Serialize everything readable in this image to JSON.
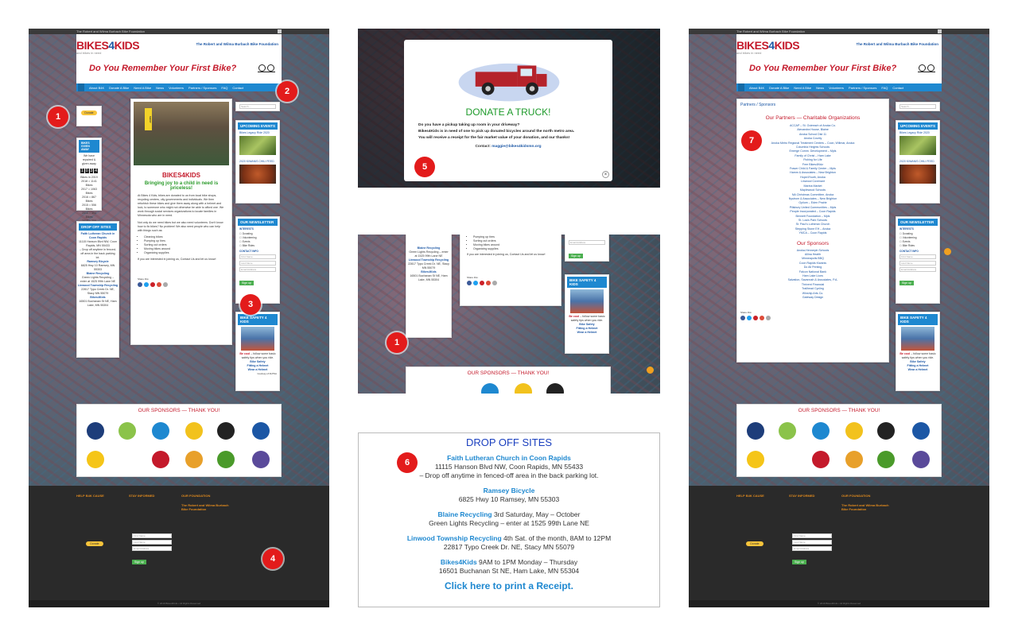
{
  "site": {
    "topbar_text": "The Robert and Wilma Burbach Bike Foundation",
    "logo_part1": "BIKES",
    "logo_part2": "4",
    "logo_part3": "KIDS",
    "tagline": "and bikes in need",
    "foundation": "The Robert and Wilma Burbach Bike Foundation",
    "headline": "Do You Remember Your First Bike?"
  },
  "nav": {
    "items_left": [
      "About B4K",
      "Donate A Bike",
      "Need A Bike",
      "News",
      "Volunteers",
      "Partners / Sponsors",
      "FAQ",
      "Contact"
    ]
  },
  "home": {
    "donate_label": "Donate",
    "bikes_given_title": "BIKES GIVEN AWAY",
    "bikes_given_sub": "We have repaired & given away",
    "counter": [
      "1",
      "0",
      "3",
      "4"
    ],
    "counter_caption": "Bikes in 2019",
    "yearly": [
      "2018 = 1141 Bikes",
      "2017 = 1063 Bikes",
      "2016 = 867 Bikes",
      "2015 = 556 Bikes",
      "2014 = 394 Bikes",
      "2013 = 359 Bikes",
      "2012 = 146 Bikes"
    ],
    "shop_sign": "SHOP",
    "main_logo": "BIKES4KIDS",
    "main_heading": "Bringing joy to a child in need is priceless!",
    "main_p1": "At Bikes 4 Kids, bikes are donated to us from local bike shops, recycling centers, city governments and individuals. We then refurbish these bikes and give them away along with a helmet and lock, to someone who might not otherwise be able to afford one. We work through social services organizations to locate families in Minnesota who are in need.",
    "main_p2": "Not only do we need bikes but we also need volunteers. Don't know how to fix bikes? No problem! We also need people who can help with things such as:",
    "main_list": [
      "Cleaning bikes",
      "Pumping up tires",
      "Sorting out orders",
      "Moving bikes around",
      "Organizing supplies"
    ],
    "main_p3": "If you are interested in joining us, Contact Us and let us know!",
    "share_label": "Share this:",
    "search_placeholder": "Search ...",
    "upcoming_title": "UPCOMING EVENTS",
    "event1": "Bikes Legacy Ride 2020",
    "event2": "2020 KIWANIS CHILI FEED",
    "newsletter_title": "OUR NEWSLETTER",
    "interests_label": "INTERESTS",
    "interests": [
      "Donating",
      "Volunteering",
      "Events",
      "Bike Rides"
    ],
    "contact_info_label": "CONTACT INFO",
    "first_name": "First Name",
    "last_name": "Last Name",
    "email": "Email Address",
    "signup": "Sign up",
    "safety_title": "BIKE SAFETY 4 KIDS",
    "safety_cool": "Be cool",
    "safety_text": " – follow some basic safety tips when you ride.",
    "safety_links": [
      "Bike Safety",
      "Fitting a Helmet",
      "Wear a Helmet"
    ],
    "safety_courtesy": "Courtesy of NHTSA",
    "dropoff_title": "DROP OFF SITES",
    "sponsors_title": "OUR SPONSORS — THANK YOU!",
    "footer_col1": "HELP B4K CAUSE",
    "footer_col2": "STAY INFORMED",
    "footer_col3": "OUR FOUNDATION",
    "footer_foundation": "The Robert and Wilma Burbach Bike Foundation",
    "copyright": "© 2019 Bikes4Kids • All Rights Reserved"
  },
  "modal": {
    "title": "DONATE A TRUCK!",
    "line1": "Do you have a pickup taking up room in your driveway?",
    "line2": "Bikes4Kids is in need of one to pick up donated bicycles around the north metro area.",
    "line3": "You will receive a receipt for the fair market value of your donation, and our thanks!",
    "contact_label": "Contact: ",
    "contact_email": "maggie@bikes4kidsmn.org",
    "close": "×"
  },
  "dropoff": {
    "title": "DROP OFF SITES",
    "sites": [
      {
        "name": "Faith Lutheran Church in Coon Rapids",
        "suffix": "",
        "line1": "11115 Hanson Blvd NW,  Coon Rapids, MN 55433",
        "line2": "– Drop off anytime in fenced-off area in the back parking lot."
      },
      {
        "name": "Ramsey Bicycle",
        "suffix": "",
        "line1": "6825 Hwy 10 Ramsey, MN 55303",
        "line2": ""
      },
      {
        "name": "Blaine Recycling",
        "suffix": " 3rd Saturday, May – October",
        "line1": "Green Lights Recycling – enter at 1525 99th Lane NE",
        "line2": ""
      },
      {
        "name": "Linwood Township Recycling",
        "suffix": " 4th Sat. of the month, 8AM to 12PM",
        "line1": "22817 Typo Creek Dr. NE, Stacy MN 55079",
        "line2": ""
      },
      {
        "name": "Bikes4Kids",
        "suffix": " 9AM to 1PM Monday – Thursday",
        "line1": "16501 Buchanan St NE, Ham Lake, MN 55304",
        "line2": ""
      }
    ],
    "receipt_link": "Click here to print a Receipt."
  },
  "partners": {
    "breadcrumb": "Partners / Sponsors",
    "heading1": "Our Partners — Charitable Organizations",
    "orgs": [
      "ACCAP – St. Outreach of Anoka Co.",
      "Alexandra House, Blaine",
      "Anoka School Dist 11",
      "Anoka County",
      "Anoka Metro Regional Treatment Centers – Coon, Willmar, Anoka",
      "Columbia Heights Schools",
      "Emerge Comm. Development – Mpls",
      "Family of Christ – Ham Lake",
      "Fishing for Life",
      "Free Bikes4Kidz",
      "Fraser Child & Family Center – Mpls",
      "Hamm & Associates – New Brighton",
      "Hope4Youth, Anoka",
      "Linwood Covenant",
      "Marina Market",
      "Maplewood Schools",
      "NA Christmas Committee, Anoka",
      "Nystrom & Associates – New Brighton",
      "Opiium – Eden Prairie",
      "Pillsbury United Communities – Mpls",
      "People Incorporated – Coon Rapids",
      "Bennett Foundation – Mpls",
      "St. Louis Park Schools",
      "St. Paul's Lutheran Church",
      "Stepping Stone EH – Anoka",
      "YMCA – Coon Rapids"
    ],
    "heading2": "Our Sponsors",
    "sponsors": [
      "Anoka-Hennepin Schools",
      "Allina Health",
      "Minneapolis BBQ",
      "Coon Rapids Kiwanis",
      "Do All Printing",
      "Falcon National Bank",
      "Ham Lake Lions",
      "Salvation, Savannah & Associates, P.A.",
      "Thrivent Financial",
      "Trailhead Cycling",
      "Winship Arts Co.",
      "Gateway Design"
    ]
  },
  "markers": [
    "1",
    "2",
    "3",
    "4",
    "1",
    "5",
    "6",
    "7"
  ]
}
